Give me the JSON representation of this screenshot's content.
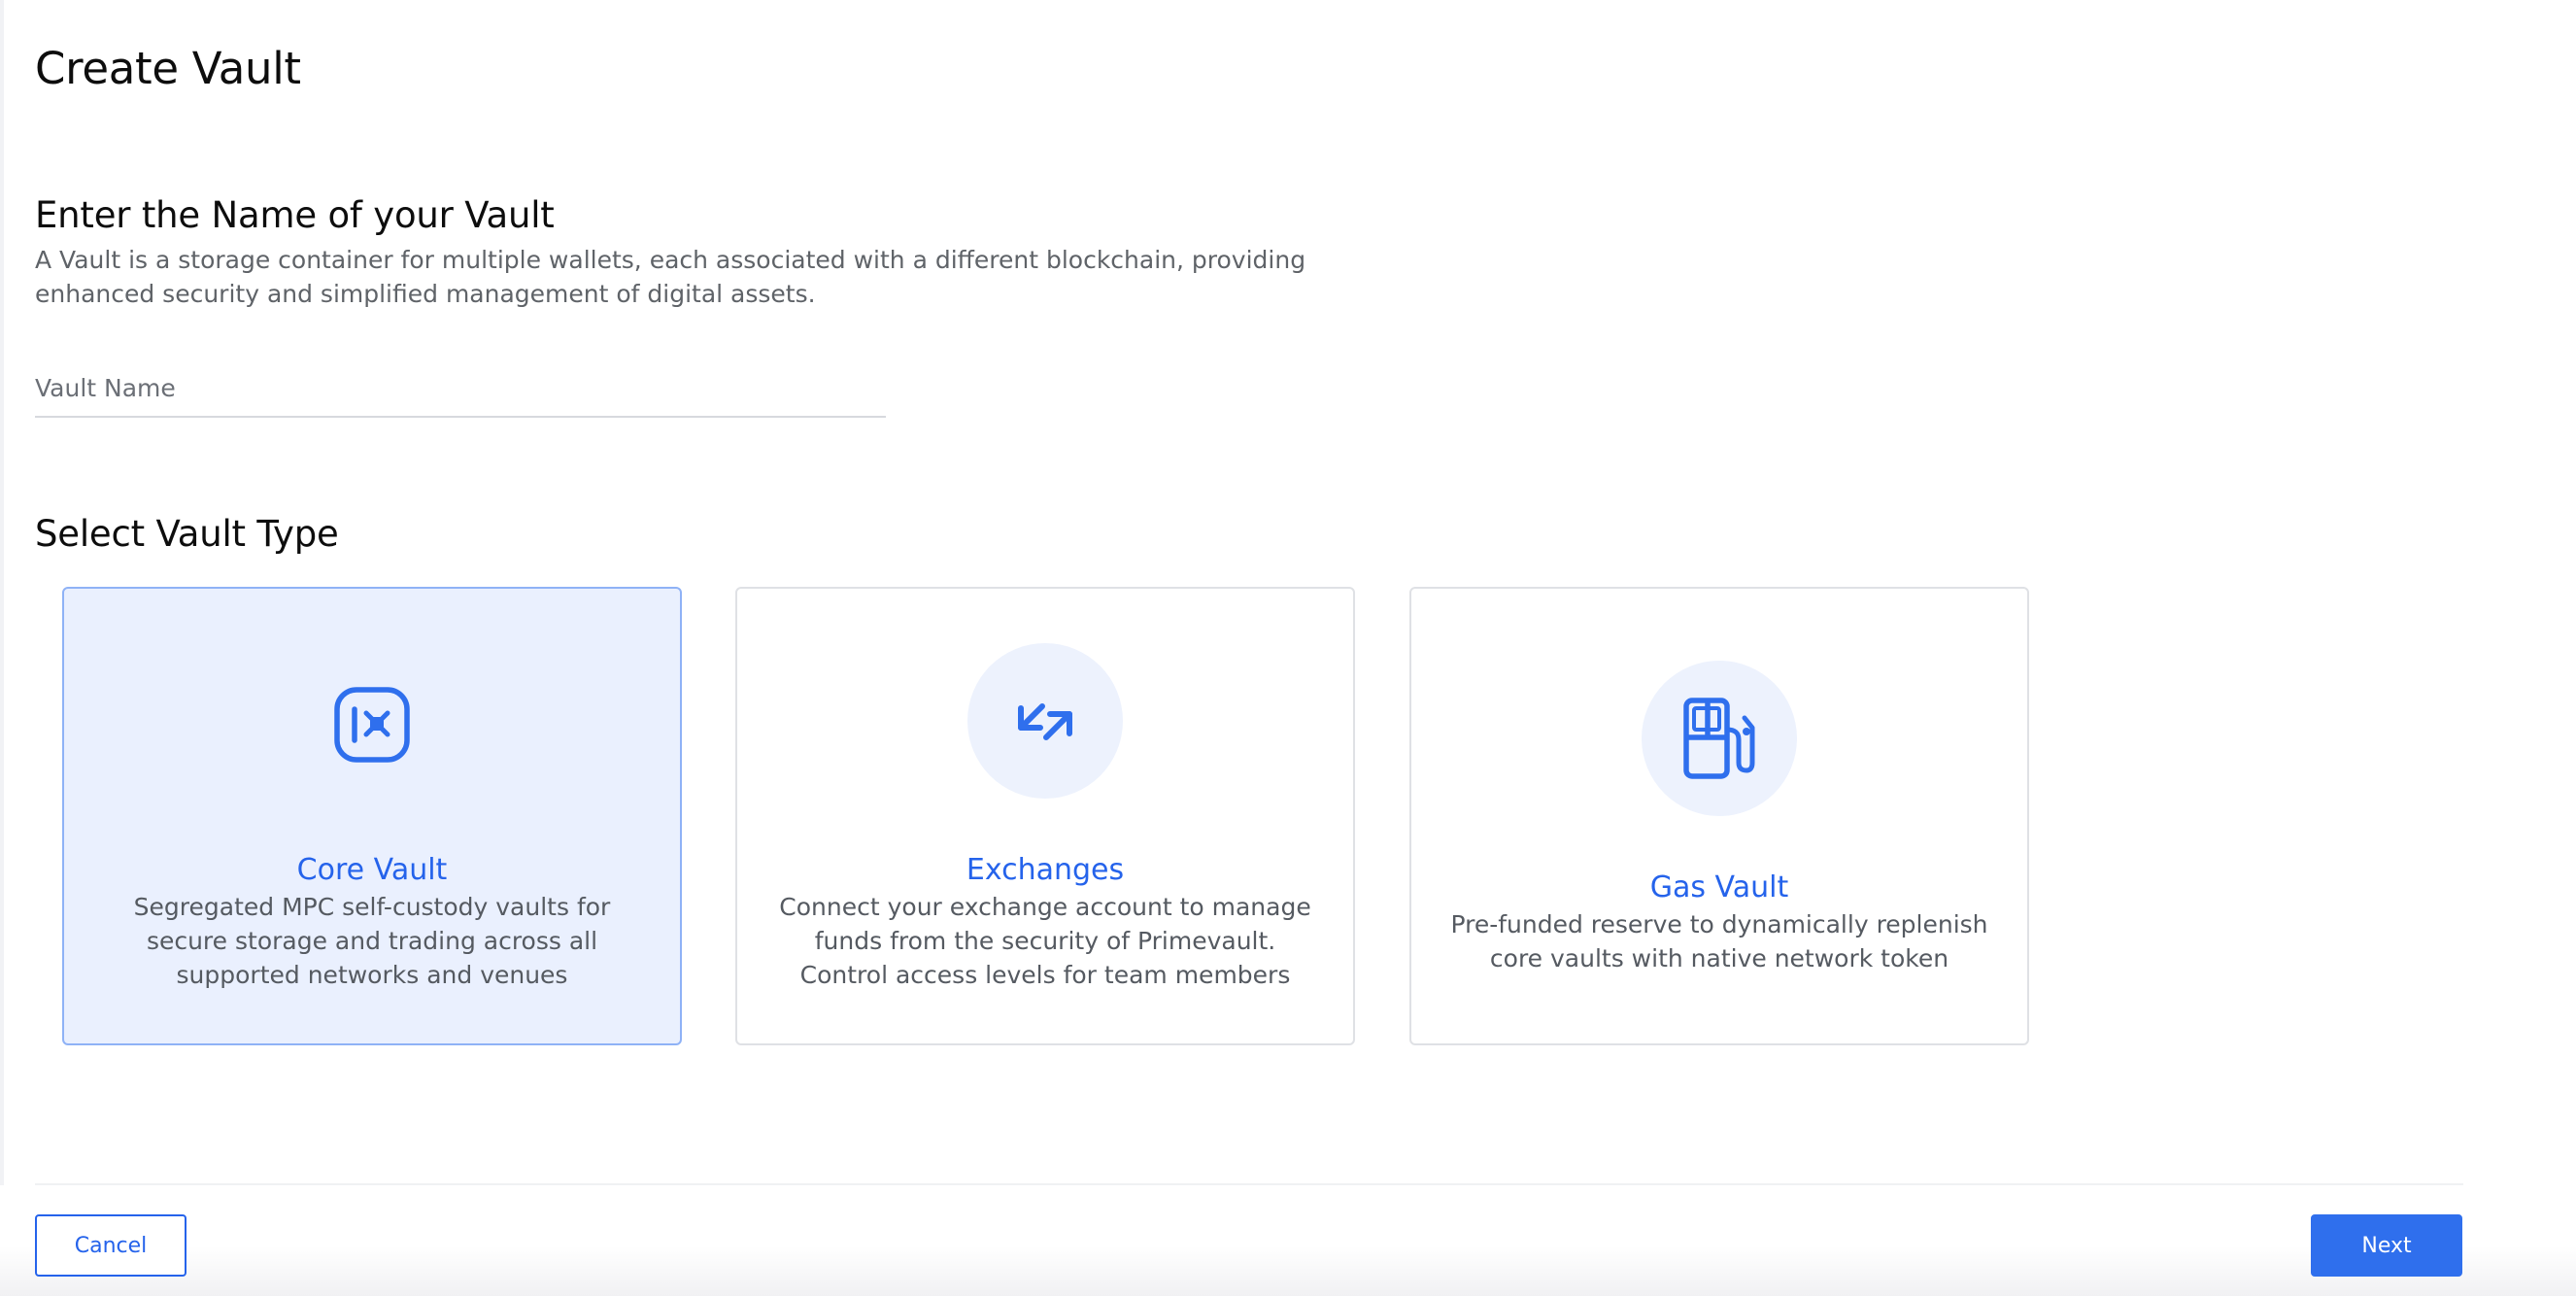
{
  "page": {
    "title": "Create Vault"
  },
  "vault_name_section": {
    "heading": "Enter the Name of your Vault",
    "description": "A Vault is a storage container for multiple wallets, each associated with a different blockchain, providing enhanced security and simplified management of digital assets.",
    "input_placeholder": "Vault Name",
    "input_value": ""
  },
  "vault_type_section": {
    "heading": "Select Vault Type",
    "selected": "Core Vault",
    "options": [
      {
        "title": "Core Vault",
        "description": "Segregated MPC self-custody vaults for secure storage and trading across all supported networks and venues",
        "icon": "vault-safe-icon"
      },
      {
        "title": "Exchanges",
        "description": "Connect your exchange account to manage funds from the security of Primevault. Control access levels for team members",
        "icon": "exchange-arrows-icon"
      },
      {
        "title": "Gas Vault",
        "description": "Pre-funded reserve to dynamically replenish core vaults with native network token",
        "icon": "gas-pump-icon"
      }
    ]
  },
  "footer": {
    "cancel_label": "Cancel",
    "next_label": "Next"
  },
  "colors": {
    "accent": "#2563eb",
    "selected_card_bg": "#eaf0fe",
    "icon_disc_bg": "#edf2fd"
  }
}
